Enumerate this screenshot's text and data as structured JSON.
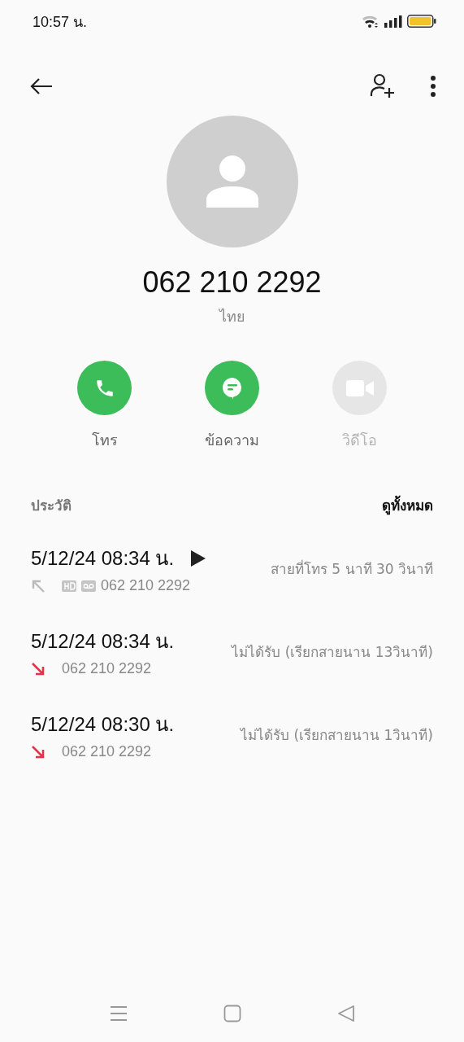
{
  "status_bar": {
    "time": "10:57 น."
  },
  "contact": {
    "name": "062 210 2292",
    "location": "ไทย"
  },
  "actions": [
    {
      "kind": "call",
      "label": "โทร",
      "disabled": false
    },
    {
      "kind": "message",
      "label": "ข้อความ",
      "disabled": false
    },
    {
      "kind": "video",
      "label": "วิดีโอ",
      "disabled": true
    }
  ],
  "history": {
    "title": "ประวัติ",
    "see_all": "ดูทั้งหมด",
    "calls": [
      {
        "kind": "outgoing",
        "date": "5/12/24 08:34 น.",
        "number": "062 210 2292",
        "hd": true,
        "volte": true,
        "playable": true,
        "detail": "สายที่โทร  5 นาที 30 วินาที"
      },
      {
        "kind": "missed",
        "date": "5/12/24 08:34 น.",
        "number": "062 210 2292",
        "hd": false,
        "volte": false,
        "playable": false,
        "detail": "ไม่ได้รับ (เรียกสายนาน 13วินาที)"
      },
      {
        "kind": "missed",
        "date": "5/12/24 08:30 น.",
        "number": "062 210 2292",
        "hd": false,
        "volte": false,
        "playable": false,
        "detail": "ไม่ได้รับ (เรียกสายนาน 1วินาที)"
      }
    ]
  }
}
